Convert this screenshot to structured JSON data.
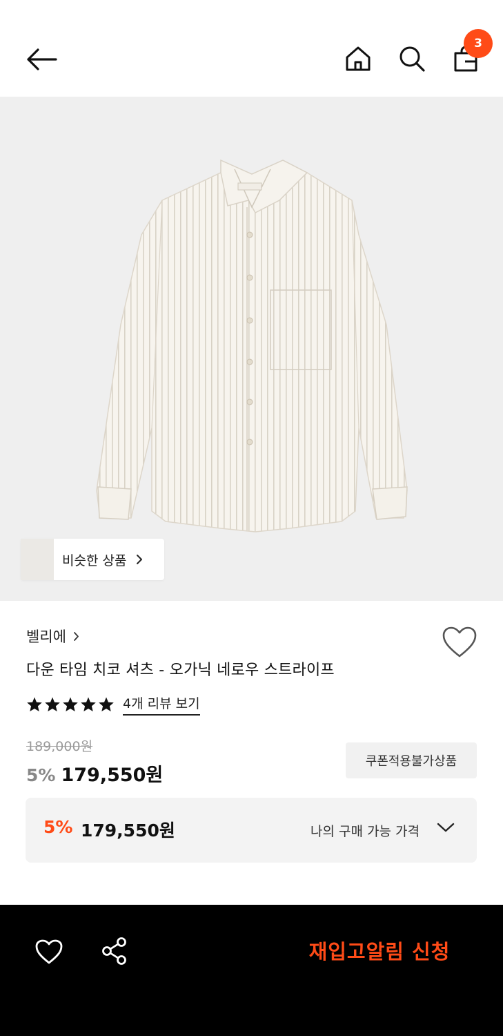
{
  "header": {
    "back_icon": "arrow-left-icon",
    "home_icon": "home-icon",
    "search_icon": "search-icon",
    "cart_icon": "shopping-bag-icon",
    "cart_count": "3",
    "badge_color": "#ff4b17"
  },
  "hero": {
    "background": "#efefef",
    "similar_label": "비슷한 상품"
  },
  "product": {
    "brand": "벨리에",
    "title": "다운 타임 치코 셔츠 - 오가닉 네로우 스트라이프",
    "rating_stars": 5,
    "review_link": "4개 리뷰 보기",
    "original_price": "189,000원",
    "discount_rate": "5%",
    "sale_price": "179,550원",
    "coupon_badge": "쿠폰적용불가상품"
  },
  "my_price": {
    "rate": "5%",
    "price": "179,550원",
    "label": "나의 구매 가능 가격"
  },
  "bottom_bar": {
    "restock_label": "재입고알림 신청",
    "accent": "#ff4b17"
  }
}
